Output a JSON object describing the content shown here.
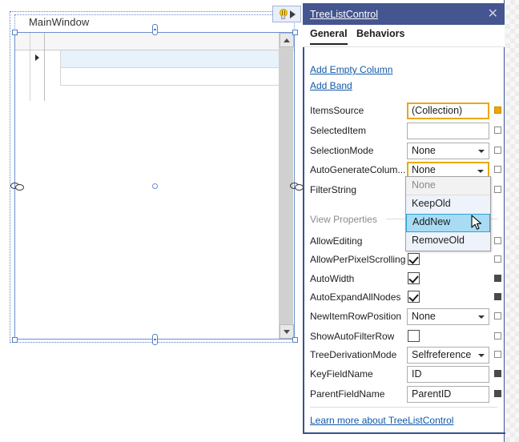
{
  "designer": {
    "window_title": "MainWindow",
    "smarttag": {
      "bulb_icon": "lightbulb-icon",
      "expand_icon": "play-triangle-icon"
    },
    "scrollbar": {
      "up_icon": "triangle-up-icon",
      "down_icon": "triangle-down-icon"
    }
  },
  "panel": {
    "title": "TreeListControl",
    "close_label": "✕",
    "tabs": [
      {
        "label": "General",
        "active": true
      },
      {
        "label": "Behaviors",
        "active": false
      }
    ],
    "actions": [
      {
        "label": "Add Empty Column"
      },
      {
        "label": "Add Band"
      }
    ],
    "properties": [
      {
        "name": "ItemsSource",
        "value": "(Collection)",
        "type": "text",
        "marker": "orange",
        "highlight": true
      },
      {
        "name": "SelectedItem",
        "value": "",
        "type": "text",
        "marker": "empty",
        "highlight": false
      },
      {
        "name": "SelectionMode",
        "value": "None",
        "type": "combo",
        "marker": "empty",
        "highlight": false
      },
      {
        "name": "AutoGenerateColum...",
        "value": "None",
        "type": "combo",
        "marker": "empty",
        "highlight": true
      },
      {
        "name": "FilterString",
        "value": "",
        "type": "text",
        "marker": "empty",
        "highlight": false
      }
    ],
    "section_title": "View Properties",
    "view_properties": [
      {
        "name": "AllowEditing",
        "value": "",
        "type": "text",
        "marker": "empty"
      },
      {
        "name": "AllowPerPixelScrolling",
        "value": true,
        "type": "checkbox",
        "marker": "empty"
      },
      {
        "name": "AutoWidth",
        "value": true,
        "type": "checkbox",
        "marker": "filled"
      },
      {
        "name": "AutoExpandAllNodes",
        "value": true,
        "type": "checkbox",
        "marker": "filled"
      },
      {
        "name": "NewItemRowPosition",
        "value": "None",
        "type": "combo",
        "marker": "empty"
      },
      {
        "name": "ShowAutoFilterRow",
        "value": false,
        "type": "checkbox",
        "marker": "empty"
      },
      {
        "name": "TreeDerivationMode",
        "value": "Selfreference",
        "type": "combo",
        "marker": "empty"
      },
      {
        "name": "KeyFieldName",
        "value": "ID",
        "type": "text",
        "marker": "filled"
      },
      {
        "name": "ParentFieldName",
        "value": "ParentID",
        "type": "text",
        "marker": "filled"
      }
    ],
    "dropdown": {
      "owner": "AutoGenerateColum...",
      "items": [
        {
          "label": "None",
          "state": "disabled"
        },
        {
          "label": "KeepOld",
          "state": "normal"
        },
        {
          "label": "AddNew",
          "state": "selected"
        },
        {
          "label": "RemoveOld",
          "state": "normal"
        }
      ]
    },
    "footer_link": "Learn more about TreeListControl"
  },
  "colors": {
    "titlebar": "#44558f",
    "link": "#1258a8",
    "highlight_border": "#e8a912",
    "dropdown_selected": "#a8dcf4",
    "selection_blue": "#6a8fd0"
  }
}
